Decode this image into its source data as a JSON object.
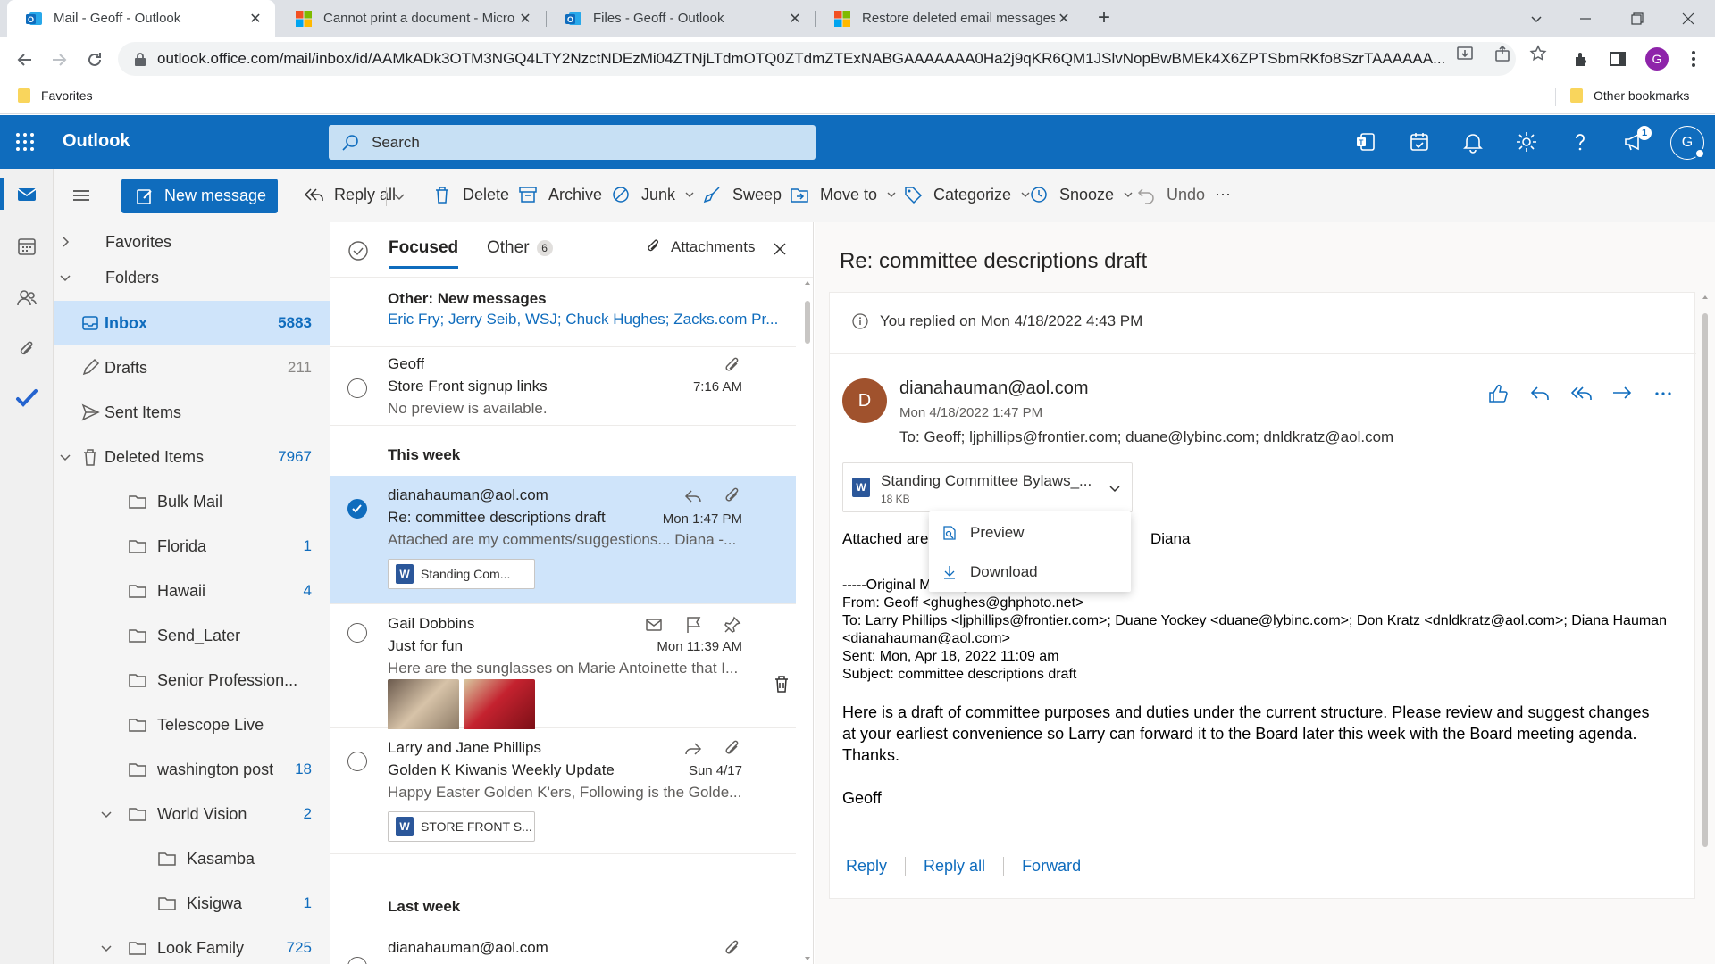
{
  "browser": {
    "tabs": [
      {
        "title": "Mail - Geoff - Outlook",
        "icon": "outlook-icon"
      },
      {
        "title": "Cannot print a document - Micro",
        "icon": "microsoft-icon"
      },
      {
        "title": "Files - Geoff - Outlook",
        "icon": "outlook-icon"
      },
      {
        "title": "Restore deleted email messages i",
        "icon": "microsoft-icon"
      }
    ],
    "close_glyph": "✕",
    "new_tab_glyph": "+",
    "url": "outlook.office.com/mail/inbox/id/AAMkADk3OTM3NGQ4LTY2NzctNDEzMi04ZTNjLTdmOTQ0ZTdmZTExNABGAAAAAAA0Ha2j9qKR6QM1JSlvNopBwBMEk4X6ZPTSbmRKfo8SzrTAAAAAA...",
    "profile_initial": "G",
    "bookmarks": {
      "left": "Favorites",
      "right": "Other bookmarks"
    }
  },
  "outlook": {
    "brand": "Outlook",
    "search_placeholder": "Search",
    "notification_count": "1",
    "user_initial": "G",
    "accent": "#0f6cbd"
  },
  "commands": {
    "new_message": "New message",
    "reply_all": "Reply all",
    "delete": "Delete",
    "archive": "Archive",
    "junk": "Junk",
    "sweep": "Sweep",
    "move_to": "Move to",
    "categorize": "Categorize",
    "snooze": "Snooze",
    "undo": "Undo",
    "more": "···"
  },
  "folders": {
    "favorites": "Favorites",
    "folders": "Folders",
    "items": [
      {
        "label": "Inbox",
        "count": "5883"
      },
      {
        "label": "Drafts",
        "count": "211"
      },
      {
        "label": "Sent Items",
        "count": ""
      },
      {
        "label": "Deleted Items",
        "count": "7967"
      },
      {
        "label": "Bulk Mail",
        "count": ""
      },
      {
        "label": "Florida",
        "count": "1"
      },
      {
        "label": "Hawaii",
        "count": "4"
      },
      {
        "label": "Send_Later",
        "count": ""
      },
      {
        "label": "Senior Profession...",
        "count": ""
      },
      {
        "label": "Telescope Live",
        "count": ""
      },
      {
        "label": "washington post",
        "count": "18"
      },
      {
        "label": "World Vision",
        "count": "2"
      },
      {
        "label": "Kasamba",
        "count": ""
      },
      {
        "label": "Kisigwa",
        "count": "1"
      },
      {
        "label": "Look Family",
        "count": "725"
      }
    ]
  },
  "list": {
    "tab_focused": "Focused",
    "tab_other": "Other",
    "other_count": "6",
    "attachments_filter": "Attachments",
    "other_notice": {
      "title": "Other: New messages",
      "senders": "Eric Fry; Jerry Seib, WSJ; Chuck Hughes; Zacks.com Pr..."
    },
    "sections": {
      "this_week": "This week",
      "last_week": "Last week"
    },
    "messages": [
      {
        "sender": "Geoff",
        "subject": "Store Front signup links",
        "preview": "No preview is available.",
        "time": "7:16 AM"
      },
      {
        "sender": "dianahauman@aol.com",
        "subject": "Re: committee descriptions draft",
        "preview": "Attached are my comments/suggestions... Diana -...",
        "time": "Mon 1:47 PM",
        "chip": "Standing Com..."
      },
      {
        "sender": "Gail Dobbins",
        "subject": "Just for fun",
        "preview": "Here are the sunglasses on Marie Antoinette that I...",
        "time": "Mon 11:39 AM"
      },
      {
        "sender": "Larry and Jane Phillips",
        "subject": "Golden K Kiwanis Weekly Update",
        "preview": "Happy Easter Golden K'ers, Following is the Golde...",
        "time": "Sun 4/17",
        "chip": "STORE FRONT S..."
      },
      {
        "sender": "dianahauman@aol.com",
        "subject": "",
        "preview": "",
        "time": ""
      }
    ]
  },
  "reading": {
    "subject": "Re: committee descriptions draft",
    "replied_notice": "You replied on Mon 4/18/2022 4:43 PM",
    "avatar_initial": "D",
    "from": "dianahauman@aol.com",
    "date": "Mon 4/18/2022 1:47 PM",
    "to": "To:  Geoff;  ljphillips@frontier.com;  duane@lybinc.com;  dnldkratz@aol.com",
    "attachment": {
      "name": "Standing Committee Bylaws_...",
      "size": "18 KB"
    },
    "menu": {
      "preview": "Preview",
      "download": "Download"
    },
    "body_intro_left": "Attached are",
    "body_intro_right": "Diana",
    "original": [
      "-----Original Message-----",
      "From: Geoff <ghughes@ghphoto.net>",
      "To: Larry Phillips <ljphillips@frontier.com>; Duane Yockey <duane@lybinc.com>; Don Kratz <dnldkratz@aol.com>; Diana Hauman",
      "<dianahauman@aol.com>",
      "Sent: Mon, Apr 18, 2022 11:09 am",
      "Subject: committee descriptions draft"
    ],
    "body": [
      "Here is a draft of committee purposes and duties under the current structure.  Please review and suggest changes",
      "at your earliest convenience so Larry can forward it to the Board later this week with the Board meeting agenda.",
      "Thanks."
    ],
    "signature": "Geoff",
    "actions": {
      "reply": "Reply",
      "reply_all": "Reply all",
      "forward": "Forward"
    }
  }
}
